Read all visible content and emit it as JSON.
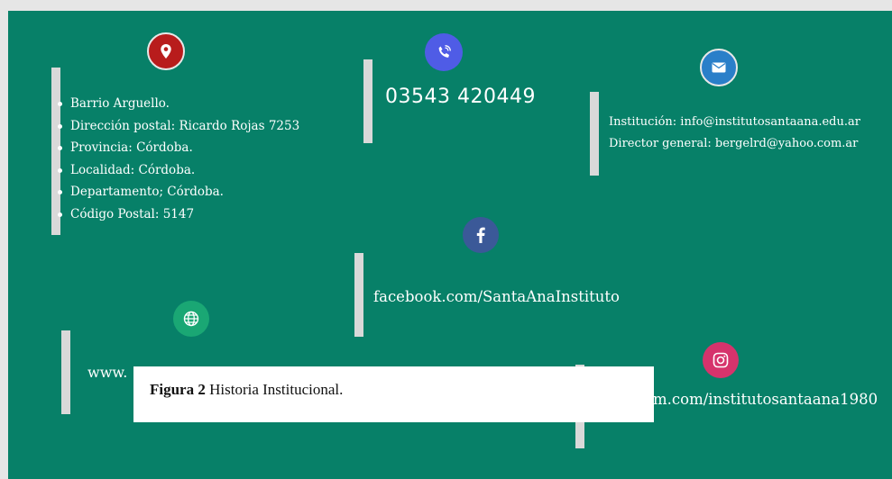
{
  "address": {
    "items": [
      "Barrio Arguello.",
      "Dirección postal: Ricardo Rojas 7253",
      "Provincia: Córdoba.",
      "Localidad: Córdoba.",
      "Departamento; Córdoba.",
      "Código Postal: 5147"
    ]
  },
  "phone": {
    "number": "03543 420449"
  },
  "email": {
    "lines": [
      "Institución: info@institutosantaana.edu.ar",
      "Director general: bergelrd@yahoo.com.ar"
    ]
  },
  "facebook": {
    "text": "facebook.com/SantaAnaInstituto"
  },
  "website": {
    "text_visible": "www."
  },
  "instagram": {
    "text_visible": "m.com/institutosantaana1980"
  },
  "caption": {
    "label": "Figura 2",
    "text": " Historia Institucional."
  },
  "icons": {
    "location": "location-pin-icon",
    "phone": "phone-icon",
    "email": "envelope-icon",
    "facebook": "facebook-icon",
    "globe": "globe-icon",
    "instagram": "instagram-icon"
  },
  "colors": {
    "background": "#078068",
    "location": "#b81c1c",
    "phone": "#4f5ce6",
    "email": "#2a7fc9",
    "facebook": "#3b5998",
    "globe": "#1aa774",
    "instagram": "#d6336c"
  }
}
